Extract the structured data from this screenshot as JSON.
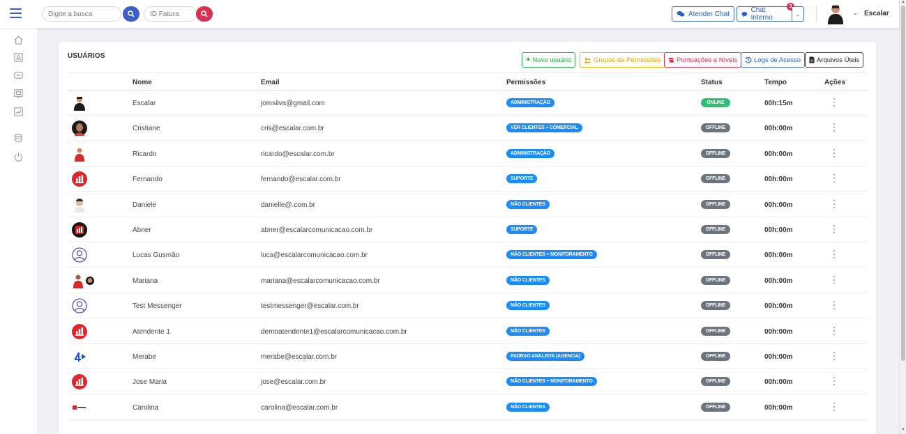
{
  "header": {
    "search_placeholder": "Digite a busca",
    "invoice_placeholder": "ID Fatura",
    "atender_chat": "Atender Chat",
    "chat_interno": "Chat Interno",
    "chat_badge": "3",
    "user_name": "Escalar"
  },
  "sidebar": {
    "icons": [
      "home-icon",
      "contacts-icon",
      "chat-icon",
      "screen-icon",
      "chart-icon",
      "database-icon",
      "power-icon"
    ]
  },
  "page": {
    "title": "USUÁRIOS",
    "buttons": {
      "novo_usuario": "Novo usuário",
      "grupos": "Grupos de Permissões",
      "pontuacoes": "Pontuações e Níveis",
      "logs": "Logs de Acesso",
      "arquivos": "Arquivos Úteis"
    }
  },
  "table": {
    "headers": [
      "Nome",
      "Email",
      "Permissões",
      "Status",
      "Tempo",
      "Ações"
    ],
    "rows": [
      {
        "name": "Escalar",
        "email": "jomsilva@gmail.com",
        "perm": "ADMINISTRAÇÃO",
        "status": "ONLINE",
        "tempo": "00h:15m",
        "avatar": "person-dark"
      },
      {
        "name": "Cristiane",
        "email": "cris@escalar.com.br",
        "perm": "VER CLIENTES + COMERCIAL",
        "status": "OFFLINE",
        "tempo": "00h:00m",
        "avatar": "person-woman"
      },
      {
        "name": "Ricardo",
        "email": "ricardo@escalar.com.br",
        "perm": "ADMINISTRAÇÃO",
        "status": "OFFLINE",
        "tempo": "00h:00m",
        "avatar": "person-red"
      },
      {
        "name": "Fernando",
        "email": "fernando@escalar.com.br",
        "perm": "SUPORTE",
        "status": "OFFLINE",
        "tempo": "00h:00m",
        "avatar": "logo-red"
      },
      {
        "name": "Daniele",
        "email": "danielle@.com.br",
        "perm": "NÃO CLIENTES",
        "status": "OFFLINE",
        "tempo": "00h:00m",
        "avatar": "person-light"
      },
      {
        "name": "Abner",
        "email": "abner@escalarcomunicacao.com.br",
        "perm": "SUPORTE",
        "status": "OFFLINE",
        "tempo": "00h:00m",
        "avatar": "logo-black"
      },
      {
        "name": "Lucas Gusmão",
        "email": "luca@escalarcomunicacao.com.br",
        "perm": "NÃO CLIENTES + MONITORAMENTO",
        "status": "OFFLINE",
        "tempo": "00h:00m",
        "avatar": "placeholder"
      },
      {
        "name": "Mariana",
        "email": "mariana@escalarcomunicacao.com.br",
        "perm": "NÃO CLIENTES",
        "status": "OFFLINE",
        "tempo": "00h:00m",
        "avatar": "person-pair"
      },
      {
        "name": "Test Messenger",
        "email": "testmessenger@escalar.com.br",
        "perm": "NÃO CLIENTES",
        "status": "OFFLINE",
        "tempo": "00h:00m",
        "avatar": "placeholder"
      },
      {
        "name": "Atendente 1",
        "email": "demoatendente1@escalarcomunicacao.com.br",
        "perm": "NÃO CLIENTES",
        "status": "OFFLINE",
        "tempo": "00h:00m",
        "avatar": "logo-red"
      },
      {
        "name": "Merabe",
        "email": "merabe@escalar.com.br",
        "perm": "PADRAO ANALISTA (AGENCIA)",
        "status": "OFFLINE",
        "tempo": "00h:00m",
        "avatar": "logo-4"
      },
      {
        "name": "Jose Maria",
        "email": "jose@escalar.com.br",
        "perm": "NÃO CLIENTES + MONITORAMENTO",
        "status": "OFFLINE",
        "tempo": "00h:00m",
        "avatar": "logo-red"
      },
      {
        "name": "Carolina",
        "email": "carolina@escalar.com.br",
        "perm": "NÃO CLIENTES",
        "status": "OFFLINE",
        "tempo": "00h:00m",
        "avatar": "logo-small"
      }
    ]
  }
}
